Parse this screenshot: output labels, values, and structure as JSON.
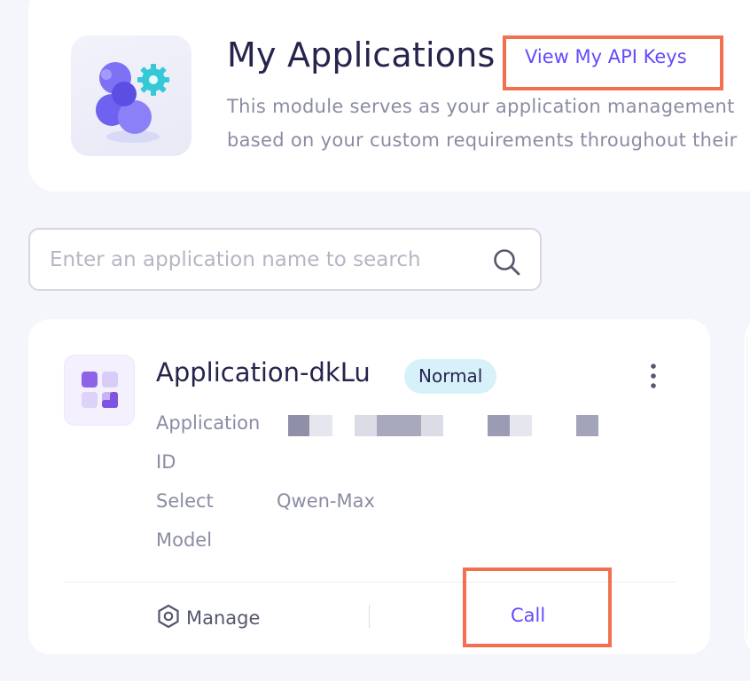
{
  "header": {
    "title": "My Applications",
    "api_keys_link": "View My API Keys",
    "description_line1": "This module serves as your application management",
    "description_line2": "based on your custom requirements throughout their"
  },
  "search": {
    "placeholder": "Enter an application name to search",
    "value": "",
    "icon": "search-icon"
  },
  "application": {
    "name": "Application-dkLu",
    "status": "Normal",
    "status_color": "#d7f1fb",
    "id_label_line1": "Application",
    "id_label_line2": "ID",
    "model_label_line1": "Select",
    "model_label_line2": "Model",
    "model_value": "Qwen-Max",
    "manage_label": "Manage",
    "manage_icon": "hexagon-gear-icon",
    "call_label": "Call",
    "more_icon": "more-vertical-icon"
  },
  "colors": {
    "accent": "#624aff",
    "highlight": "#f2704f",
    "text_primary": "#26244c",
    "text_secondary": "#8a8ca3",
    "background": "#f5f6fb"
  }
}
